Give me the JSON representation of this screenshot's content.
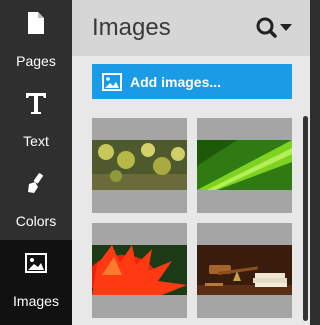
{
  "nav": {
    "items": [
      {
        "label": "Pages",
        "icon": "page-icon"
      },
      {
        "label": "Text",
        "icon": "text-icon"
      },
      {
        "label": "Colors",
        "icon": "paintbrush-icon"
      },
      {
        "label": "Images",
        "icon": "image-icon",
        "active": true
      }
    ]
  },
  "panel": {
    "title": "Images",
    "search_icon": "search-icon",
    "add_button_label": "Add images...",
    "thumbnails": [
      {
        "subject": "yellow-leaves"
      },
      {
        "subject": "green-leaf"
      },
      {
        "subject": "red-flower"
      },
      {
        "subject": "gavel-books"
      }
    ]
  },
  "colors": {
    "sidebar": "#2f2f2f",
    "sidebar_active": "#111111",
    "accent": "#1a9be6",
    "panel_bg": "#e8e8e8",
    "header_bg": "#d6d6d6"
  }
}
